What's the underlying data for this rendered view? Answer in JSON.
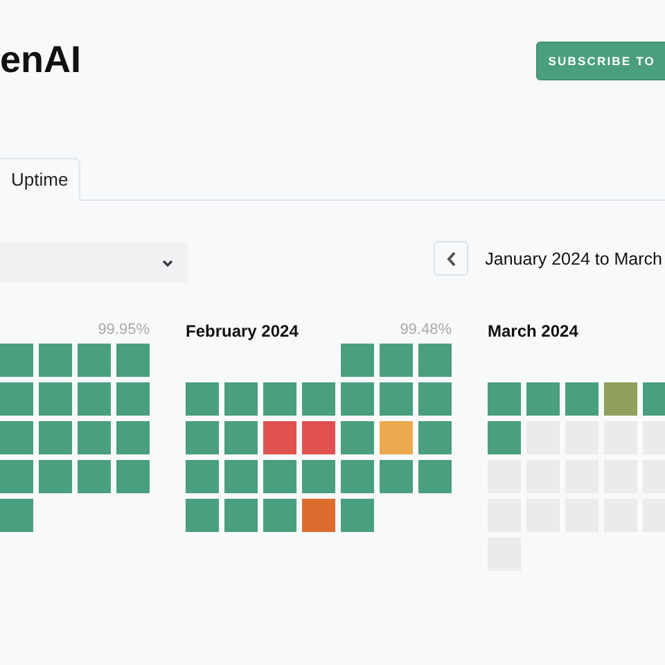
{
  "header": {
    "title": "enAI",
    "subscribe_button": "SUBSCRIBE TO"
  },
  "tabs": [
    {
      "label": "Uptime",
      "selected": true
    }
  ],
  "date_range": {
    "label": "January 2024 to March"
  },
  "months": [
    {
      "uptime": "99.95%",
      "weeks": [
        [
          {
            "color": "#4a9f7e"
          },
          {
            "color": "#4a9f7e"
          },
          {
            "color": "#4a9f7e"
          },
          {
            "color": "#4a9f7e"
          }
        ],
        [
          {
            "color": "#4a9f7e"
          },
          {
            "color": "#4a9f7e"
          },
          {
            "color": "#4a9f7e"
          },
          {
            "color": "#4a9f7e"
          }
        ],
        [
          {
            "color": "#4a9f7e"
          },
          {
            "color": "#4a9f7e"
          },
          {
            "color": "#4a9f7e"
          },
          {
            "color": "#4a9f7e"
          }
        ],
        [
          {
            "color": "#4a9f7e"
          },
          {
            "color": "#4a9f7e"
          },
          {
            "color": "#4a9f7e"
          },
          {
            "color": "#4a9f7e"
          }
        ],
        [
          {
            "color": "#4a9f7e"
          }
        ]
      ]
    },
    {
      "title": "February 2024",
      "uptime": "99.48%",
      "weeks": [
        [
          {
            "kind": "empty"
          },
          {
            "kind": "empty"
          },
          {
            "kind": "empty"
          },
          {
            "kind": "empty"
          },
          {
            "kind": "day",
            "color": "#4a9f7e"
          },
          {
            "kind": "day",
            "color": "#4a9f7e"
          },
          {
            "kind": "day",
            "color": "#4a9f7e"
          }
        ],
        [
          {
            "color": "#4a9f7e"
          },
          {
            "color": "#4a9f7e"
          },
          {
            "color": "#4a9f7e"
          },
          {
            "color": "#4a9f7e"
          },
          {
            "color": "#4a9f7e"
          },
          {
            "color": "#4a9f7e"
          },
          {
            "color": "#4a9f7e"
          }
        ],
        [
          {
            "color": "#4a9f7e"
          },
          {
            "color": "#4a9f7e"
          },
          {
            "color": "#e05252"
          },
          {
            "color": "#e05252"
          },
          {
            "color": "#4a9f7e"
          },
          {
            "color": "#eaa94d"
          },
          {
            "color": "#4a9f7e"
          }
        ],
        [
          {
            "color": "#4a9f7e"
          },
          {
            "color": "#4a9f7e"
          },
          {
            "color": "#4a9f7e"
          },
          {
            "color": "#4a9f7e"
          },
          {
            "color": "#4a9f7e"
          },
          {
            "color": "#4a9f7e"
          },
          {
            "color": "#4a9f7e"
          }
        ],
        [
          {
            "color": "#4a9f7e"
          },
          {
            "color": "#4a9f7e"
          },
          {
            "color": "#4a9f7e"
          },
          {
            "color": "#dc6d2e"
          },
          {
            "color": "#4a9f7e"
          }
        ]
      ]
    },
    {
      "title": "March 2024",
      "weeks": [
        [
          {
            "kind": "empty"
          },
          {
            "kind": "empty"
          },
          {
            "kind": "empty"
          },
          {
            "kind": "empty"
          },
          {
            "kind": "empty"
          }
        ],
        [
          {
            "color": "#4a9f7e"
          },
          {
            "color": "#4a9f7e"
          },
          {
            "color": "#4a9f7e"
          },
          {
            "color": "#8fa15d"
          },
          {
            "color": "#4a9f7e"
          }
        ],
        [
          {
            "color": "#4a9f7e"
          },
          {
            "color": "#ebebeb"
          },
          {
            "color": "#ebebeb"
          },
          {
            "color": "#ebebeb"
          },
          {
            "color": "#ebebeb"
          }
        ],
        [
          {
            "color": "#ebebeb"
          },
          {
            "color": "#ebebeb"
          },
          {
            "color": "#ebebeb"
          },
          {
            "color": "#ebebeb"
          },
          {
            "color": "#ebebeb"
          }
        ],
        [
          {
            "color": "#ebebeb"
          },
          {
            "color": "#ebebeb"
          },
          {
            "color": "#ebebeb"
          },
          {
            "color": "#ebebeb"
          },
          {
            "color": "#ebebeb"
          }
        ],
        [
          {
            "color": "#ebebeb"
          }
        ]
      ]
    }
  ]
}
